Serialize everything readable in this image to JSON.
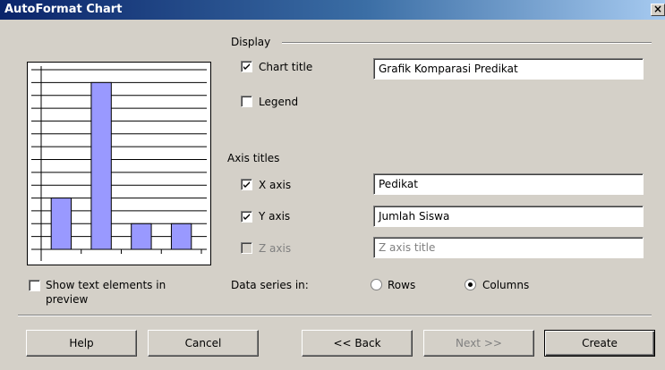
{
  "window": {
    "title": "AutoFormat Chart",
    "close_label": "×"
  },
  "display": {
    "section_label": "Display",
    "chart_title": {
      "label": "Chart title",
      "checked": true,
      "value": "Grafik Komparasi Predikat"
    },
    "legend": {
      "label": "Legend",
      "checked": false
    }
  },
  "axis_titles": {
    "section_label": "Axis titles",
    "x_axis": {
      "label": "X axis",
      "checked": true,
      "value": "Pedikat"
    },
    "y_axis": {
      "label": "Y axis",
      "checked": true,
      "value": "Jumlah Siswa"
    },
    "z_axis": {
      "label": "Z axis",
      "checked": false,
      "disabled": true,
      "placeholder": "Z axis title"
    }
  },
  "preview": {
    "show_text_label_line1": "Show text elements in",
    "show_text_label_line2": "preview",
    "show_text_checked": false
  },
  "chart_data": {
    "type": "bar",
    "series": [
      {
        "values": [
          2,
          6.5,
          1,
          1
        ]
      }
    ],
    "ylim": [
      0,
      7
    ],
    "bar_color": "#9999ff",
    "grid": true
  },
  "data_series": {
    "label": "Data series in:",
    "rows_label": "Rows",
    "columns_label": "Columns",
    "selected": "columns"
  },
  "buttons": {
    "help": "Help",
    "cancel": "Cancel",
    "back": "<< Back",
    "next": "Next >>",
    "create": "Create"
  }
}
